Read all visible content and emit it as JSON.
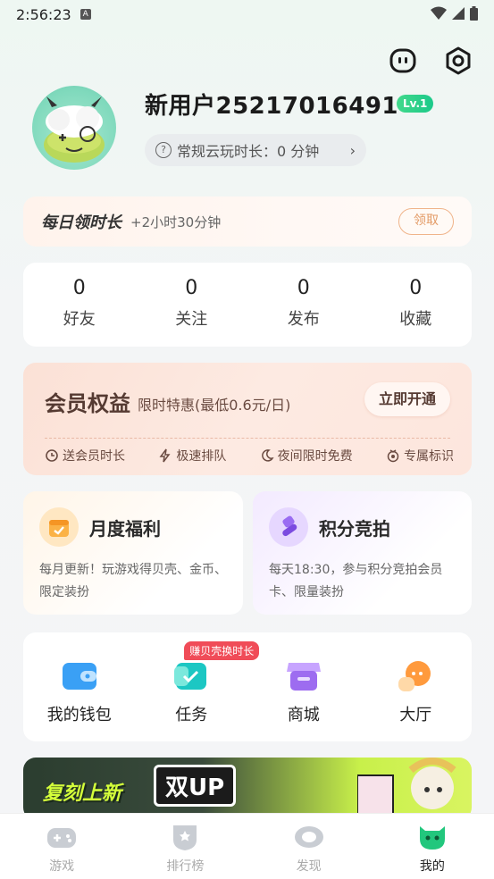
{
  "status_bar": {
    "time": "2:56:23"
  },
  "profile": {
    "username": "新用户25217016491",
    "level": "Lv.1",
    "playtime_label": "常规云玩时长：",
    "playtime_value": "0 分钟"
  },
  "daily": {
    "title": "每日领时长",
    "gain": "+2小时30分钟",
    "claim": "领取"
  },
  "stats": [
    {
      "value": "0",
      "label": "好友"
    },
    {
      "value": "0",
      "label": "关注"
    },
    {
      "value": "0",
      "label": "发布"
    },
    {
      "value": "0",
      "label": "收藏"
    }
  ],
  "vip": {
    "title": "会员权益",
    "subtitle": "限时特惠(最低0.6元/日)",
    "open_button": "立即开通",
    "perks": [
      "送会员时长",
      "极速排队",
      "夜间限时免费",
      "专属标识"
    ]
  },
  "monthly": {
    "title": "月度福利",
    "desc": "每月更新！玩游戏得贝壳、金币、限定装扮"
  },
  "auction": {
    "title": "积分竞拍",
    "desc": "每天18:30，参与积分竞拍会员卡、限量装扮"
  },
  "shortcuts": [
    {
      "label": "我的钱包"
    },
    {
      "label": "任务",
      "tip": "赚贝壳换时长"
    },
    {
      "label": "商城"
    },
    {
      "label": "大厅"
    }
  ],
  "banner": {
    "text": "复刻上新",
    "badge": "双UP"
  },
  "tabs": [
    {
      "label": "游戏",
      "active": false
    },
    {
      "label": "排行榜",
      "active": false
    },
    {
      "label": "发现",
      "active": false
    },
    {
      "label": "我的",
      "active": true
    }
  ],
  "colors": {
    "accent_green": "#1cc98a",
    "vip_brown": "#553a32",
    "tip_red": "#f04c58"
  }
}
